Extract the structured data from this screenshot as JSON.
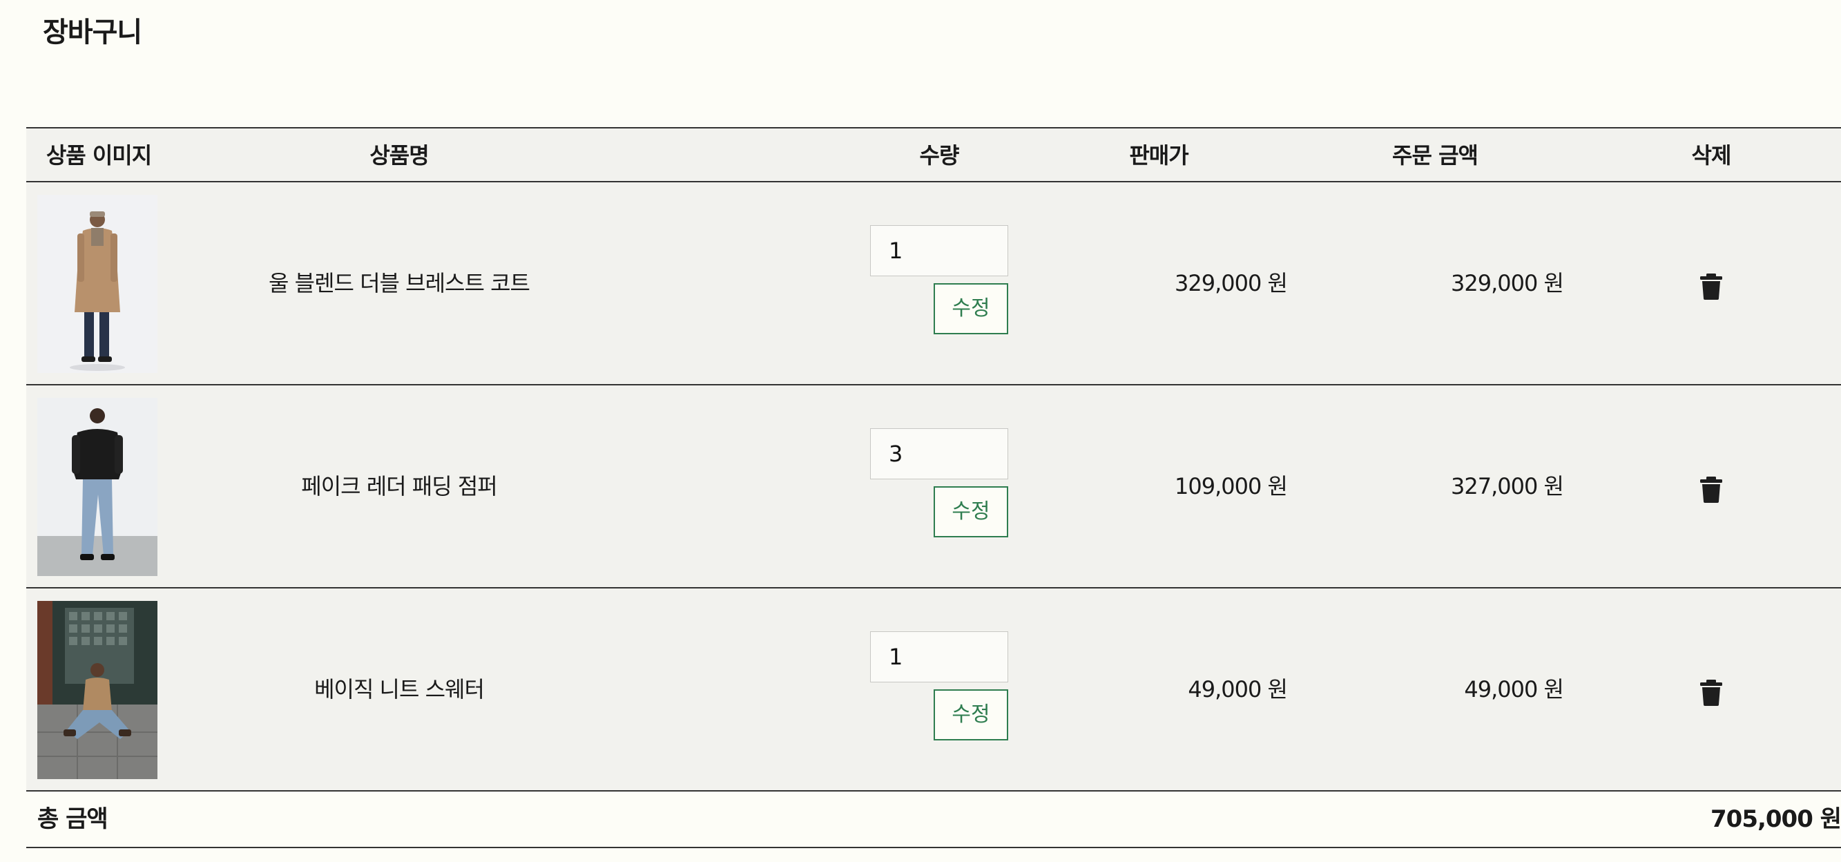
{
  "page": {
    "title": "장바구니"
  },
  "table": {
    "headers": {
      "image": "상품 이미지",
      "name": "상품명",
      "quantity": "수량",
      "sale_price": "판매가",
      "order_amount": "주문 금액",
      "delete": "삭제"
    },
    "rows": [
      {
        "name": "울 블렌드 더블 브레스트 코트",
        "quantity": "1",
        "edit_label": "수정",
        "sale_price": "329,000 원",
        "order_amount": "329,000 원",
        "image_icon": "product-photo-coat"
      },
      {
        "name": "페이크 레더 패딩 점퍼",
        "quantity": "3",
        "edit_label": "수정",
        "sale_price": "109,000 원",
        "order_amount": "327,000 원",
        "image_icon": "product-photo-jumper"
      },
      {
        "name": "베이직 니트 스웨터",
        "quantity": "1",
        "edit_label": "수정",
        "sale_price": "49,000 원",
        "order_amount": "49,000 원",
        "image_icon": "product-photo-sweater"
      }
    ]
  },
  "summary": {
    "label": "총 금액",
    "value": "705,000 원"
  },
  "colors": {
    "accent": "#2e7d4f",
    "row_background": "#f2f2ee",
    "page_background": "#fdfdf7"
  }
}
